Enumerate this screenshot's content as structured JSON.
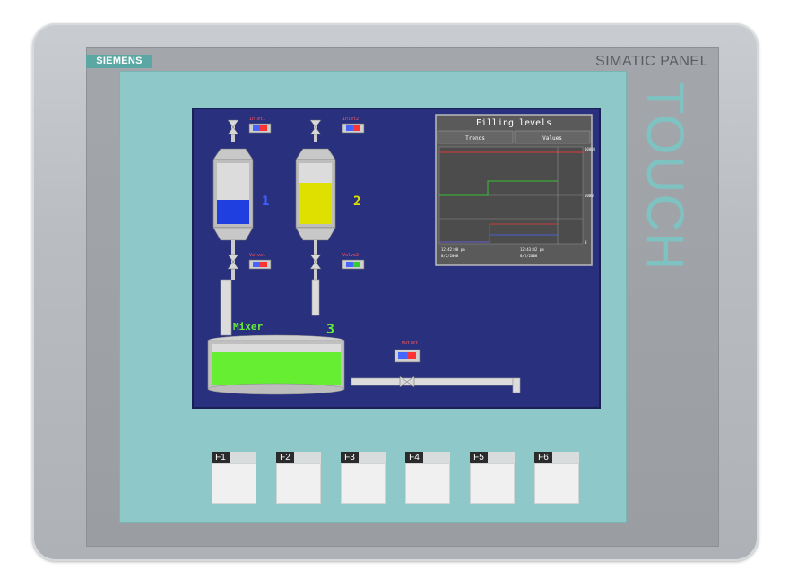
{
  "brand": "SIEMENS",
  "model": "SIMATIC PANEL",
  "model_vertical": "TOUCH",
  "colors": {
    "screen_bg": "#29317f",
    "blue_fill": "#1f3fe0",
    "yellow_fill": "#e0e000",
    "green_fill": "#66ee33",
    "trend_panel": "#5a5a5a",
    "teal_frame": "#8ec8c8"
  },
  "hmi": {
    "tank1": {
      "number": "1",
      "level": 0.4
    },
    "tank2": {
      "number": "2",
      "level": 0.68
    },
    "mixer": {
      "label": "Mixer",
      "number": "3",
      "level": 0.8
    },
    "valves": {
      "inlet1": "Inlet1",
      "inlet2": "Inlet2",
      "valve1": "Valve1",
      "valve2": "Valve2",
      "outlet": "Outlet"
    },
    "trend": {
      "title": "Filling levels",
      "tab_trends": "Trends",
      "tab_values": "Values",
      "y_ticks": [
        "10000",
        "5000",
        "0"
      ],
      "x_labels_row1": [
        "12:42:00 pm",
        "12:43:42 pm"
      ],
      "x_labels_row2": [
        "8/2/2008",
        "8/2/2008"
      ]
    }
  },
  "fkeys": [
    {
      "label": "F1"
    },
    {
      "label": "F2"
    },
    {
      "label": "F3"
    },
    {
      "label": "F4"
    },
    {
      "label": "F5"
    },
    {
      "label": "F6"
    }
  ]
}
